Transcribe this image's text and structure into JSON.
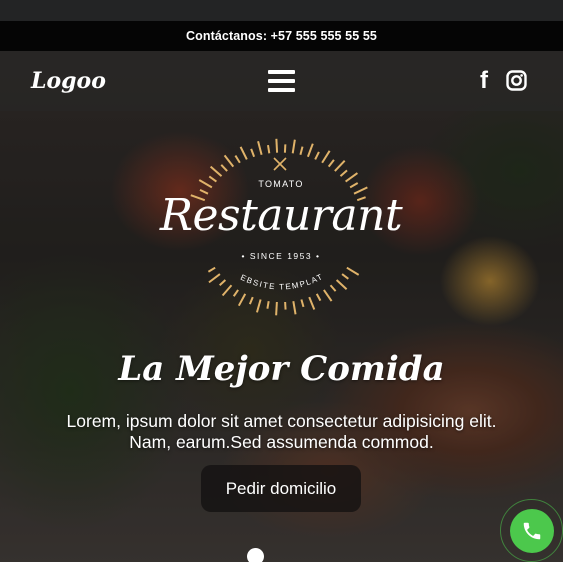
{
  "contact_bar": {
    "text": "Contáctanos: +57 555 555 55 55"
  },
  "navbar": {
    "logo": "Logoo",
    "menu_icon": "hamburger-menu-icon",
    "social": [
      {
        "name": "facebook-icon",
        "glyph": "f"
      },
      {
        "name": "instagram-icon"
      }
    ]
  },
  "emblem": {
    "top_label": "TOMATO",
    "title": "Restaurant",
    "since": "• SINCE 1953 •",
    "bottom_arc": "WEBSITE TEMPLATE",
    "accent_color": "#e0b36a"
  },
  "hero": {
    "headline": "La Mejor Comida",
    "description_line1": "Lorem, ipsum dolor sit amet consectetur adipisicing elit.",
    "description_line2": "Nam, earum.Sed assumenda commod.",
    "cta": "Pedir domicilio"
  },
  "floating": {
    "phone_icon": "phone-icon",
    "phone_color": "#4cc84c"
  }
}
